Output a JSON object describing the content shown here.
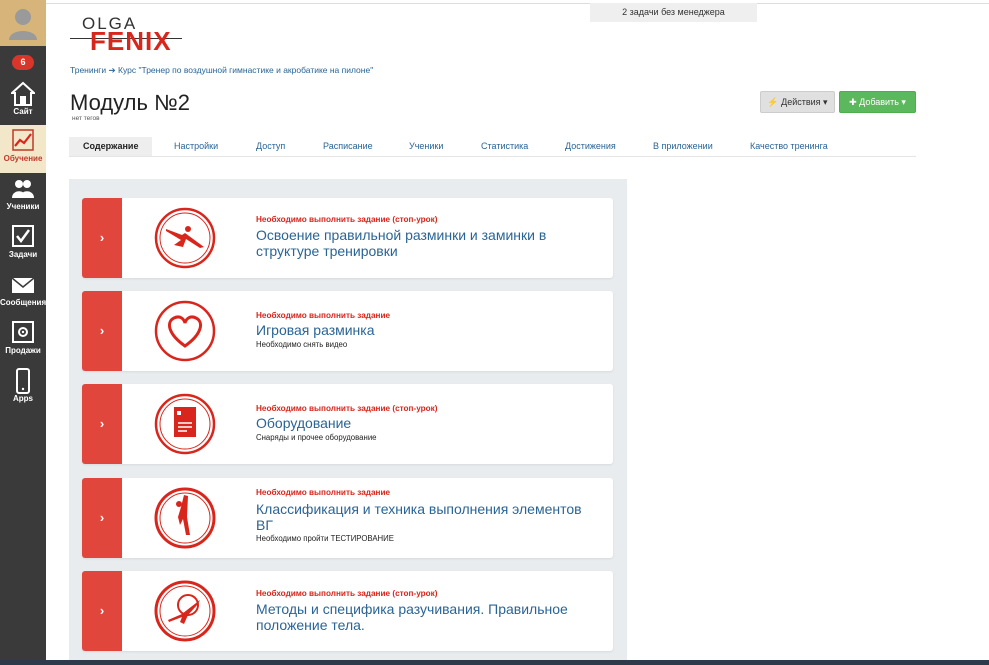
{
  "top_notice": "2 задачи без менеджера",
  "logo": {
    "top": "OLGA",
    "bottom": "FENIX"
  },
  "sidebar": {
    "badge": "6",
    "items": [
      {
        "label": "Сайт",
        "icon": "home-icon"
      },
      {
        "label": "Обучение",
        "icon": "chart-icon",
        "active": true
      },
      {
        "label": "Ученики",
        "icon": "users-icon"
      },
      {
        "label": "Задачи",
        "icon": "checkbox-icon"
      },
      {
        "label": "Сообщения",
        "icon": "envelope-icon"
      },
      {
        "label": "Продажи",
        "icon": "safe-icon"
      },
      {
        "label": "Apps",
        "icon": "phone-icon"
      }
    ]
  },
  "breadcrumb": {
    "root": "Тренинги",
    "arrow": "➔",
    "course": "Курс \"Тренер по воздушной гимнастике и акробатике на пилоне\""
  },
  "page": {
    "title": "Модуль №2",
    "tags": "нет тегов"
  },
  "buttons": {
    "actions": "⚡ Действия ▾",
    "add": "✚ Добавить ▾"
  },
  "tabs": [
    "Содержание",
    "Настройки",
    "Доступ",
    "Расписание",
    "Ученики",
    "Статистика",
    "Достижения",
    "В приложении",
    "Качество тренинга"
  ],
  "lessons": [
    {
      "status": "Необходимо выполнить задание (стоп-урок)",
      "title": "Освоение правильной разминки и заминки в структуре тренировки",
      "sub": "",
      "icon": "gymnast-leap-icon"
    },
    {
      "status": "Необходимо выполнить задание",
      "title": "Игровая разминка",
      "sub": "Необходимо снять видео",
      "icon": "heart-icon"
    },
    {
      "status": "Необходимо выполнить задание (стоп-урок)",
      "title": "Оборудование",
      "sub": "Снаряды и прочее оборудование",
      "icon": "document-icon"
    },
    {
      "status": "Необходимо выполнить задание",
      "title": "Классификация и техника выполнения элементов ВГ",
      "sub": "Необходимо пройти ТЕСТИРОВАНИЕ",
      "icon": "gymnast-split-icon"
    },
    {
      "status": "Необходимо выполнить задание (стоп-урок)",
      "title": "Методы и специфика разучивания. Правильное положение тела.",
      "sub": "",
      "icon": "aerial-hoop-icon"
    }
  ],
  "colors": {
    "accent": "#d9261c",
    "strip": "#e0463c",
    "link": "#2a6496",
    "add": "#5cb85c"
  }
}
